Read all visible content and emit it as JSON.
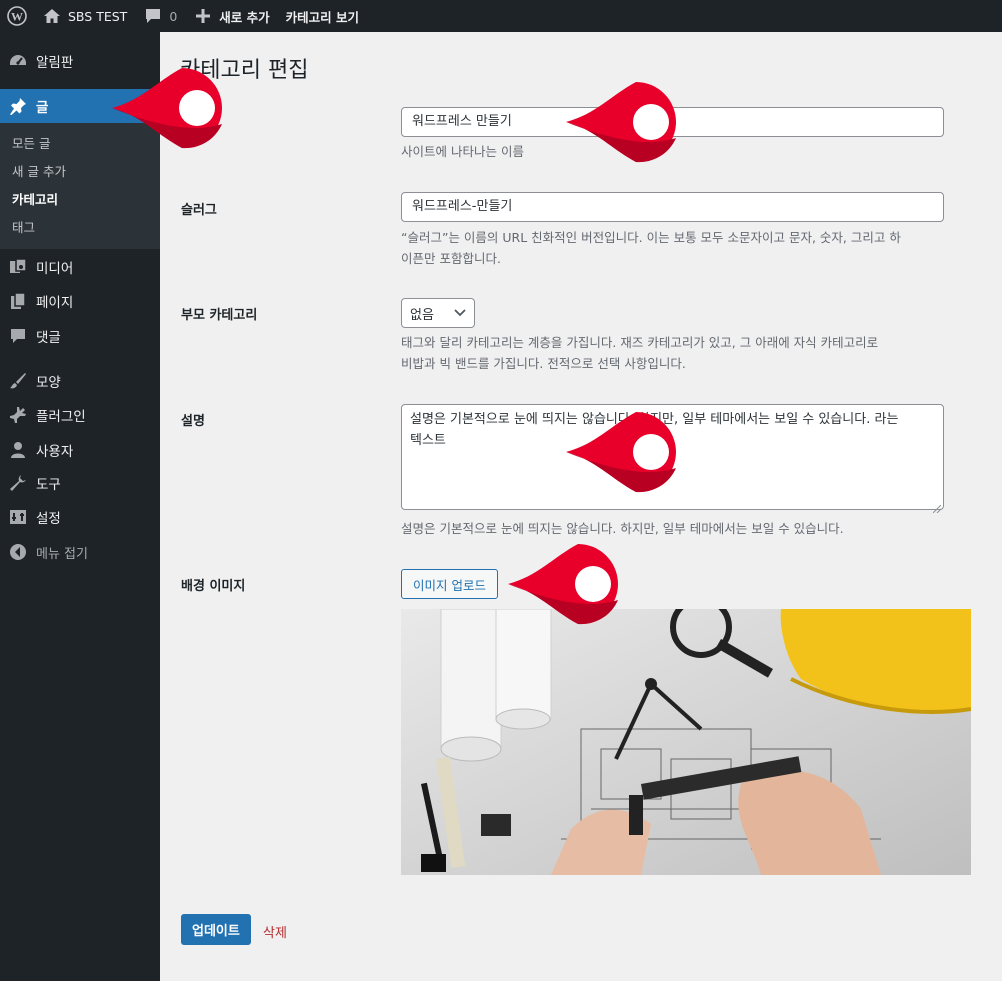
{
  "adminbar": {
    "site_name": "SBS TEST",
    "comments_count": "0",
    "new_label": "새로 추가",
    "view_category": "카테고리 보기"
  },
  "sidebar": {
    "items": [
      {
        "label": "알림판",
        "icon": "dashboard-icon"
      },
      {
        "label": "글",
        "icon": "pushpin-icon"
      },
      {
        "label": "미디어",
        "icon": "media-icon"
      },
      {
        "label": "페이지",
        "icon": "pages-icon"
      },
      {
        "label": "댓글",
        "icon": "comments-icon"
      },
      {
        "label": "모양",
        "icon": "appearance-icon"
      },
      {
        "label": "플러그인",
        "icon": "plugins-icon"
      },
      {
        "label": "사용자",
        "icon": "users-icon"
      },
      {
        "label": "도구",
        "icon": "tools-icon"
      },
      {
        "label": "설정",
        "icon": "settings-icon"
      },
      {
        "label": "메뉴 접기",
        "icon": "collapse-icon"
      }
    ],
    "submenu": [
      "모든 글",
      "새 글 추가",
      "카테고리",
      "태그"
    ]
  },
  "page": {
    "title": "카테고리 편집",
    "name_label": "이름",
    "name_value": "워드프레스 만들기",
    "name_desc": "사이트에 나타나는 이름",
    "slug_label": "슬러그",
    "slug_value": "워드프레스-만들기",
    "slug_desc_1": "“슬러그”는 이름의 URL 친화적인 버전입니다. 이는 보통 모두 소문자이고 문자, 숫자, 그리고 하",
    "slug_desc_2": "이픈만 포함합니다.",
    "parent_label": "부모 카테고리",
    "parent_value": "없음",
    "parent_desc_1": "태그와 달리 카테고리는 계층을 가집니다. 재즈 카테고리가 있고, 그 아래에 자식 카테고리로",
    "parent_desc_2": "비밥과 빅 밴드를 가집니다. 전적으로 선택 사항입니다.",
    "description_label": "설명",
    "description_value_1": "설명은 기본적으로 눈에 띄지는 않습니다. 하지만, 일부 테마에서는 보일 수 있습니다. 라는",
    "description_value_2": "텍스트",
    "description_desc": "설명은 기본적으로 눈에 띄지는 않습니다. 하지만, 일부 테마에서는 보일 수 있습니다.",
    "bg_label": "배경 이미지",
    "upload_button": "이미지 업로드",
    "update_button": "업데이트",
    "delete_link": "삭제"
  },
  "colors": {
    "accent": "#2271b1",
    "pin": "#e8002b",
    "delete": "#b32d2e"
  }
}
